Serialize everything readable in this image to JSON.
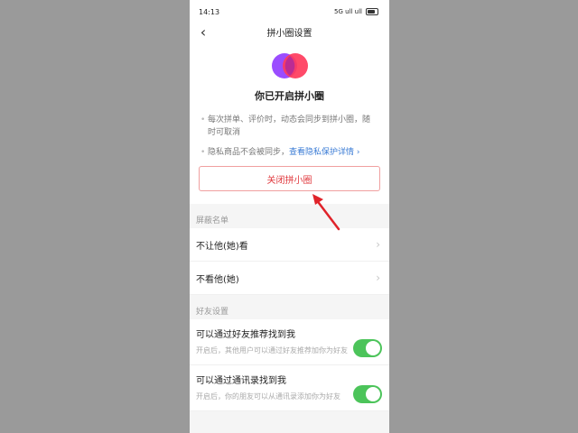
{
  "status_bar": {
    "time": "14:13",
    "indicators": "5G ull ull",
    "battery_label": ""
  },
  "nav": {
    "title": "拼小圈设置"
  },
  "hero": {
    "title": "你已开启拼小圈"
  },
  "bullets": [
    {
      "text": "每次拼单、评价时，动态会同步到拼小圈，随时可取消"
    },
    {
      "text": "隐私商品不会被同步，",
      "link": "查看隐私保护详情 ›"
    }
  ],
  "close_button_label": "关闭拼小圈",
  "block_section": {
    "header": "屏蔽名单",
    "items": [
      {
        "label": "不让他(她)看"
      },
      {
        "label": "不看他(她)"
      }
    ]
  },
  "friend_section": {
    "header": "好友设置",
    "items": [
      {
        "title": "可以通过好友推荐找到我",
        "desc": "开启后，其他用户可以通过好友推荐加你为好友",
        "on": true
      },
      {
        "title": "可以通过通讯录找到我",
        "desc": "开启后，你的朋友可以从通讯录添加你为好友",
        "on": true
      }
    ]
  },
  "colors": {
    "accent_red": "#e0393e",
    "toggle_green": "#4cc45a",
    "link_blue": "#3a7bd5"
  }
}
